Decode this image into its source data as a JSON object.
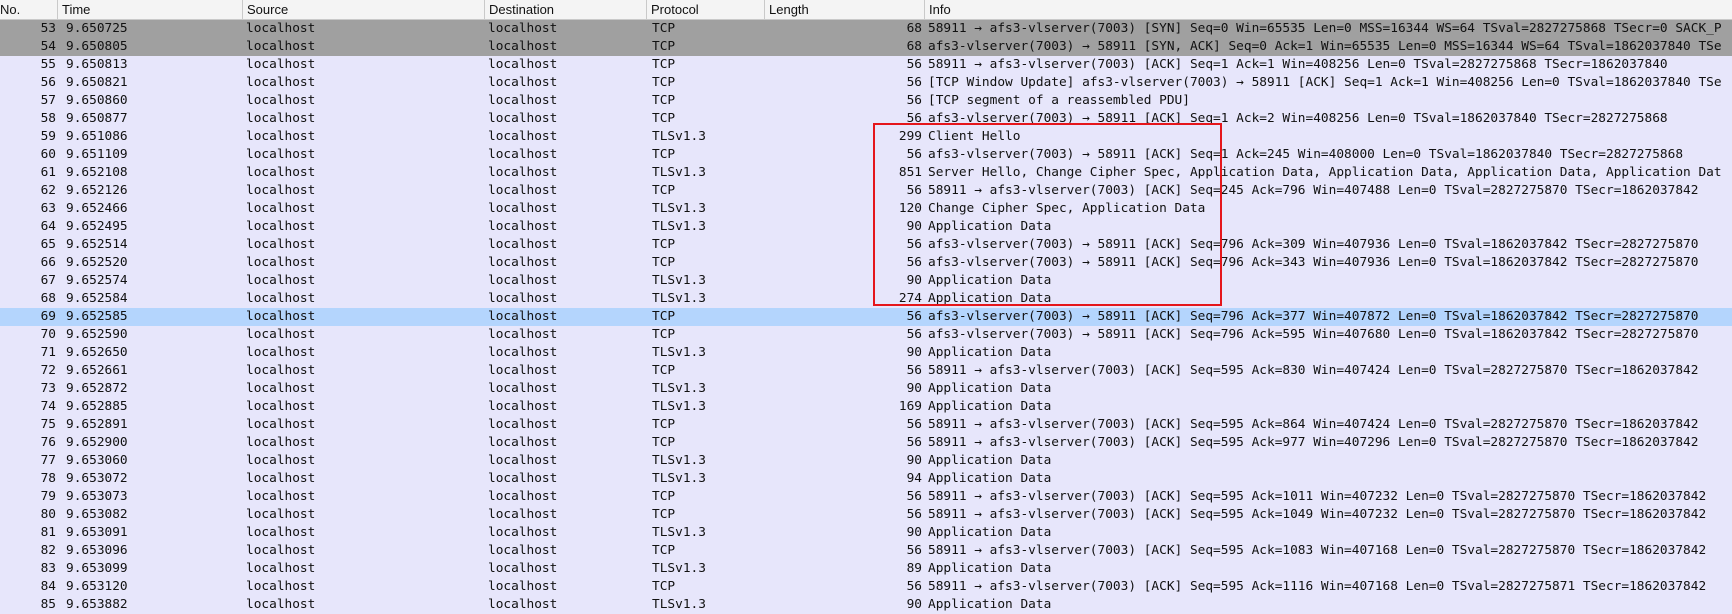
{
  "columns": [
    "No.",
    "Time",
    "Source",
    "Destination",
    "Protocol",
    "Length",
    "Info"
  ],
  "colors": {
    "syn_row": "#a0a0a0",
    "selected_row": "#b4d5fd",
    "default_row": "#e7e6fb",
    "annotation_box": "#e5161b"
  },
  "selected_no": "69",
  "packets": [
    {
      "no": "53",
      "time": "9.650725",
      "src": "localhost",
      "dst": "localhost",
      "proto": "TCP",
      "len": "68",
      "info": "58911 → afs3-vlserver(7003) [SYN] Seq=0 Win=65535 Len=0 MSS=16344 WS=64 TSval=2827275868 TSecr=0 SACK_P",
      "style": "syn"
    },
    {
      "no": "54",
      "time": "9.650805",
      "src": "localhost",
      "dst": "localhost",
      "proto": "TCP",
      "len": "68",
      "info": "afs3-vlserver(7003) → 58911 [SYN, ACK] Seq=0 Ack=1 Win=65535 Len=0 MSS=16344 WS=64 TSval=1862037840 TSe",
      "style": "syn"
    },
    {
      "no": "55",
      "time": "9.650813",
      "src": "localhost",
      "dst": "localhost",
      "proto": "TCP",
      "len": "56",
      "info": "58911 → afs3-vlserver(7003) [ACK] Seq=1 Ack=1 Win=408256 Len=0 TSval=2827275868 TSecr=1862037840",
      "style": ""
    },
    {
      "no": "56",
      "time": "9.650821",
      "src": "localhost",
      "dst": "localhost",
      "proto": "TCP",
      "len": "56",
      "info": "[TCP Window Update] afs3-vlserver(7003) → 58911 [ACK] Seq=1 Ack=1 Win=408256 Len=0 TSval=1862037840 TSe",
      "style": ""
    },
    {
      "no": "57",
      "time": "9.650860",
      "src": "localhost",
      "dst": "localhost",
      "proto": "TCP",
      "len": "56",
      "info": "[TCP segment of a reassembled PDU]",
      "style": ""
    },
    {
      "no": "58",
      "time": "9.650877",
      "src": "localhost",
      "dst": "localhost",
      "proto": "TCP",
      "len": "56",
      "info": "afs3-vlserver(7003) → 58911 [ACK] Seq=1 Ack=2 Win=408256 Len=0 TSval=1862037840 TSecr=2827275868",
      "style": ""
    },
    {
      "no": "59",
      "time": "9.651086",
      "src": "localhost",
      "dst": "localhost",
      "proto": "TLSv1.3",
      "len": "299",
      "info": "Client Hello",
      "style": ""
    },
    {
      "no": "60",
      "time": "9.651109",
      "src": "localhost",
      "dst": "localhost",
      "proto": "TCP",
      "len": "56",
      "info": "afs3-vlserver(7003) → 58911 [ACK] Seq=1 Ack=245 Win=408000 Len=0 TSval=1862037840 TSecr=2827275868",
      "style": ""
    },
    {
      "no": "61",
      "time": "9.652108",
      "src": "localhost",
      "dst": "localhost",
      "proto": "TLSv1.3",
      "len": "851",
      "info": "Server Hello, Change Cipher Spec, Application Data, Application Data, Application Data, Application Dat",
      "style": ""
    },
    {
      "no": "62",
      "time": "9.652126",
      "src": "localhost",
      "dst": "localhost",
      "proto": "TCP",
      "len": "56",
      "info": "58911 → afs3-vlserver(7003) [ACK] Seq=245 Ack=796 Win=407488 Len=0 TSval=2827275870 TSecr=1862037842",
      "style": ""
    },
    {
      "no": "63",
      "time": "9.652466",
      "src": "localhost",
      "dst": "localhost",
      "proto": "TLSv1.3",
      "len": "120",
      "info": "Change Cipher Spec, Application Data",
      "style": ""
    },
    {
      "no": "64",
      "time": "9.652495",
      "src": "localhost",
      "dst": "localhost",
      "proto": "TLSv1.3",
      "len": "90",
      "info": "Application Data",
      "style": ""
    },
    {
      "no": "65",
      "time": "9.652514",
      "src": "localhost",
      "dst": "localhost",
      "proto": "TCP",
      "len": "56",
      "info": "afs3-vlserver(7003) → 58911 [ACK] Seq=796 Ack=309 Win=407936 Len=0 TSval=1862037842 TSecr=2827275870",
      "style": ""
    },
    {
      "no": "66",
      "time": "9.652520",
      "src": "localhost",
      "dst": "localhost",
      "proto": "TCP",
      "len": "56",
      "info": "afs3-vlserver(7003) → 58911 [ACK] Seq=796 Ack=343 Win=407936 Len=0 TSval=1862037842 TSecr=2827275870",
      "style": ""
    },
    {
      "no": "67",
      "time": "9.652574",
      "src": "localhost",
      "dst": "localhost",
      "proto": "TLSv1.3",
      "len": "90",
      "info": "Application Data",
      "style": ""
    },
    {
      "no": "68",
      "time": "9.652584",
      "src": "localhost",
      "dst": "localhost",
      "proto": "TLSv1.3",
      "len": "274",
      "info": "Application Data",
      "style": ""
    },
    {
      "no": "69",
      "time": "9.652585",
      "src": "localhost",
      "dst": "localhost",
      "proto": "TCP",
      "len": "56",
      "info": "afs3-vlserver(7003) → 58911 [ACK] Seq=796 Ack=377 Win=407872 Len=0 TSval=1862037842 TSecr=2827275870",
      "style": "sel"
    },
    {
      "no": "70",
      "time": "9.652590",
      "src": "localhost",
      "dst": "localhost",
      "proto": "TCP",
      "len": "56",
      "info": "afs3-vlserver(7003) → 58911 [ACK] Seq=796 Ack=595 Win=407680 Len=0 TSval=1862037842 TSecr=2827275870",
      "style": ""
    },
    {
      "no": "71",
      "time": "9.652650",
      "src": "localhost",
      "dst": "localhost",
      "proto": "TLSv1.3",
      "len": "90",
      "info": "Application Data",
      "style": ""
    },
    {
      "no": "72",
      "time": "9.652661",
      "src": "localhost",
      "dst": "localhost",
      "proto": "TCP",
      "len": "56",
      "info": "58911 → afs3-vlserver(7003) [ACK] Seq=595 Ack=830 Win=407424 Len=0 TSval=2827275870 TSecr=1862037842",
      "style": ""
    },
    {
      "no": "73",
      "time": "9.652872",
      "src": "localhost",
      "dst": "localhost",
      "proto": "TLSv1.3",
      "len": "90",
      "info": "Application Data",
      "style": ""
    },
    {
      "no": "74",
      "time": "9.652885",
      "src": "localhost",
      "dst": "localhost",
      "proto": "TLSv1.3",
      "len": "169",
      "info": "Application Data",
      "style": ""
    },
    {
      "no": "75",
      "time": "9.652891",
      "src": "localhost",
      "dst": "localhost",
      "proto": "TCP",
      "len": "56",
      "info": "58911 → afs3-vlserver(7003) [ACK] Seq=595 Ack=864 Win=407424 Len=0 TSval=2827275870 TSecr=1862037842",
      "style": ""
    },
    {
      "no": "76",
      "time": "9.652900",
      "src": "localhost",
      "dst": "localhost",
      "proto": "TCP",
      "len": "56",
      "info": "58911 → afs3-vlserver(7003) [ACK] Seq=595 Ack=977 Win=407296 Len=0 TSval=2827275870 TSecr=1862037842",
      "style": ""
    },
    {
      "no": "77",
      "time": "9.653060",
      "src": "localhost",
      "dst": "localhost",
      "proto": "TLSv1.3",
      "len": "90",
      "info": "Application Data",
      "style": ""
    },
    {
      "no": "78",
      "time": "9.653072",
      "src": "localhost",
      "dst": "localhost",
      "proto": "TLSv1.3",
      "len": "94",
      "info": "Application Data",
      "style": ""
    },
    {
      "no": "79",
      "time": "9.653073",
      "src": "localhost",
      "dst": "localhost",
      "proto": "TCP",
      "len": "56",
      "info": "58911 → afs3-vlserver(7003) [ACK] Seq=595 Ack=1011 Win=407232 Len=0 TSval=2827275870 TSecr=1862037842",
      "style": ""
    },
    {
      "no": "80",
      "time": "9.653082",
      "src": "localhost",
      "dst": "localhost",
      "proto": "TCP",
      "len": "56",
      "info": "58911 → afs3-vlserver(7003) [ACK] Seq=595 Ack=1049 Win=407232 Len=0 TSval=2827275870 TSecr=1862037842",
      "style": ""
    },
    {
      "no": "81",
      "time": "9.653091",
      "src": "localhost",
      "dst": "localhost",
      "proto": "TLSv1.3",
      "len": "90",
      "info": "Application Data",
      "style": ""
    },
    {
      "no": "82",
      "time": "9.653096",
      "src": "localhost",
      "dst": "localhost",
      "proto": "TCP",
      "len": "56",
      "info": "58911 → afs3-vlserver(7003) [ACK] Seq=595 Ack=1083 Win=407168 Len=0 TSval=2827275870 TSecr=1862037842",
      "style": ""
    },
    {
      "no": "83",
      "time": "9.653099",
      "src": "localhost",
      "dst": "localhost",
      "proto": "TLSv1.3",
      "len": "89",
      "info": "Application Data",
      "style": ""
    },
    {
      "no": "84",
      "time": "9.653120",
      "src": "localhost",
      "dst": "localhost",
      "proto": "TCP",
      "len": "56",
      "info": "58911 → afs3-vlserver(7003) [ACK] Seq=595 Ack=1116 Win=407168 Len=0 TSval=2827275871 TSecr=1862037842",
      "style": ""
    },
    {
      "no": "85",
      "time": "9.653882",
      "src": "localhost",
      "dst": "localhost",
      "proto": "TLSv1.3",
      "len": "90",
      "info": "Application Data",
      "style": ""
    }
  ]
}
